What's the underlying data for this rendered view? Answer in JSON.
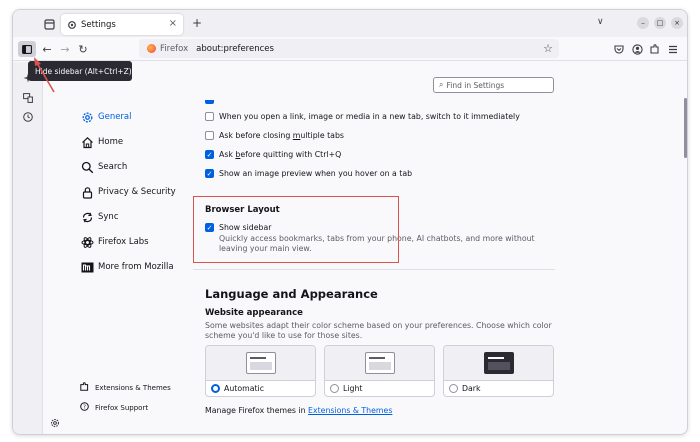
{
  "tab": {
    "title": "Settings",
    "close": "×",
    "new_tab": "+"
  },
  "window_controls": {
    "minimize": "–",
    "maximize": "□",
    "close": "×",
    "list_tabs": "∨"
  },
  "navbar": {
    "back": "←",
    "forward": "→",
    "reload": "↻",
    "identity_label": "Firefox",
    "url": "about:preferences",
    "bookmark_star": "☆"
  },
  "tooltip": {
    "text": "Hide sidebar (Alt+Ctrl+Z)"
  },
  "search": {
    "placeholder": "Find in Settings"
  },
  "pref_nav": {
    "items": [
      {
        "label": "General",
        "icon": "gear-icon",
        "active": true
      },
      {
        "label": "Home",
        "icon": "home-icon"
      },
      {
        "label": "Search",
        "icon": "search-icon"
      },
      {
        "label": "Privacy & Security",
        "icon": "lock-icon"
      },
      {
        "label": "Sync",
        "icon": "sync-icon"
      },
      {
        "label": "Firefox Labs",
        "icon": "flask-icon"
      },
      {
        "label": "More from Mozilla",
        "icon": "mozilla-icon"
      }
    ],
    "footer": [
      {
        "label": "Extensions & Themes",
        "icon": "puzzle-icon"
      },
      {
        "label": "Firefox Support",
        "icon": "help-icon"
      }
    ]
  },
  "tabs_section": {
    "options": [
      {
        "pre": "When you open a link, image or media in a new tab, switch to it immediately",
        "checked": false
      },
      {
        "pre": "Ask before closing ",
        "under": "m",
        "post": "ultiple tabs",
        "checked": false
      },
      {
        "pre": "Ask ",
        "under": "b",
        "post": "efore quitting with Ctrl+Q",
        "checked": true
      },
      {
        "pre": "Show an image preview when you hover on a tab",
        "checked": true
      }
    ]
  },
  "browser_layout": {
    "title": "Browser Layout",
    "show_sidebar_label": "Show sidebar",
    "show_sidebar_checked": true,
    "description": "Quickly access bookmarks, tabs from your phone, AI chatbots, and more without leaving your main view."
  },
  "language_appearance": {
    "heading": "Language and Appearance",
    "website_appearance_heading": "Website appearance",
    "website_appearance_desc": "Some websites adapt their color scheme based on your preferences. Choose which color scheme you'd like to use for those sites.",
    "themes": [
      {
        "label": "Automatic",
        "selected": true
      },
      {
        "label": "Light",
        "selected": false
      },
      {
        "label": "Dark",
        "selected": false
      }
    ],
    "manage_prefix": "Manage Firefox themes in ",
    "manage_link": "Extensions & Themes"
  },
  "colors": {
    "accent": "#0061e0",
    "highlight": "#d9534f"
  }
}
